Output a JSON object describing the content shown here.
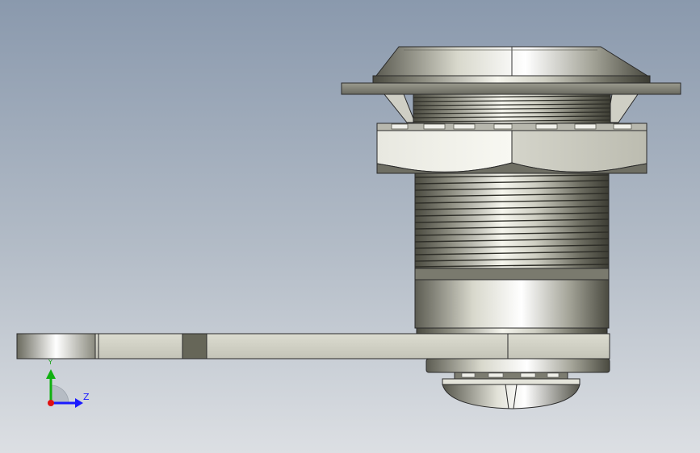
{
  "view": {
    "background_top": "#8a99ad",
    "background_bottom": "#dcdfe3"
  },
  "triad": {
    "z_label": "Z",
    "y_label": "Y",
    "x_color": "#e01010",
    "y_color": "#10b010",
    "z_color": "#1a1aff"
  },
  "model": {
    "part": "cam-lock",
    "components": [
      "head-cap",
      "flange",
      "hex-nut",
      "threaded-barrel",
      "plain-collar",
      "cam-arm",
      "back-screw-head"
    ],
    "metal_highlight": "#f4f4ec",
    "metal_shadow": "#3f3f36",
    "outline_color": "#2a2a2a"
  }
}
